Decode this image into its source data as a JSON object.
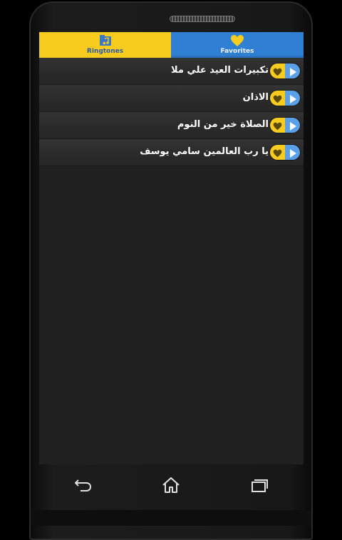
{
  "tabs": {
    "ringtones": {
      "label": "Ringtones",
      "icon": "music-folder-icon"
    },
    "favorites": {
      "label": "Favorites",
      "icon": "heart-icon"
    }
  },
  "ringtones": [
    {
      "title": "تكبيرات العيد علي ملا"
    },
    {
      "title": "الاذان"
    },
    {
      "title": "الصلاة خير من النوم"
    },
    {
      "title": "يا رب العالمين سامي يوسف"
    }
  ],
  "navigation": {
    "back": "back-icon",
    "home": "home-icon",
    "recents": "recents-icon"
  },
  "colors": {
    "accent_yellow": "#f7cc1f",
    "accent_blue": "#2f7fd3",
    "play_blue": "#5aa0e8",
    "list_bg": "#202020"
  }
}
